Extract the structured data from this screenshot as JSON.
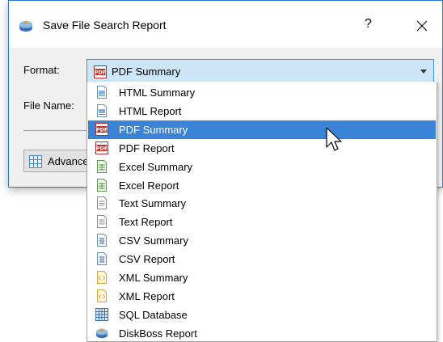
{
  "dialog": {
    "title": "Save File Search Report",
    "help_label": "?",
    "title_icon": "diskboss-icon"
  },
  "form": {
    "format_label": "Format:",
    "format_value": "PDF Summary",
    "filename_label": "File Name:",
    "advanced_label": "Advanced"
  },
  "dropdown": {
    "selected_index": 2,
    "options": [
      {
        "label": "HTML Summary",
        "icon": "html-icon"
      },
      {
        "label": "HTML Report",
        "icon": "html-icon"
      },
      {
        "label": "PDF Summary",
        "icon": "pdf-icon"
      },
      {
        "label": "PDF Report",
        "icon": "pdf-icon"
      },
      {
        "label": "Excel Summary",
        "icon": "excel-icon"
      },
      {
        "label": "Excel Report",
        "icon": "excel-icon"
      },
      {
        "label": "Text Summary",
        "icon": "text-icon"
      },
      {
        "label": "Text Report",
        "icon": "text-icon"
      },
      {
        "label": "CSV Summary",
        "icon": "csv-icon"
      },
      {
        "label": "CSV Report",
        "icon": "csv-icon"
      },
      {
        "label": "XML Summary",
        "icon": "xml-icon"
      },
      {
        "label": "XML Report",
        "icon": "xml-icon"
      },
      {
        "label": "SQL Database",
        "icon": "database-icon"
      },
      {
        "label": "DiskBoss Report",
        "icon": "diskboss-icon"
      }
    ]
  },
  "colors": {
    "selection": "#3a83d6",
    "combo_bg": "#cde6f7",
    "accent_border": "#2b78d4"
  }
}
